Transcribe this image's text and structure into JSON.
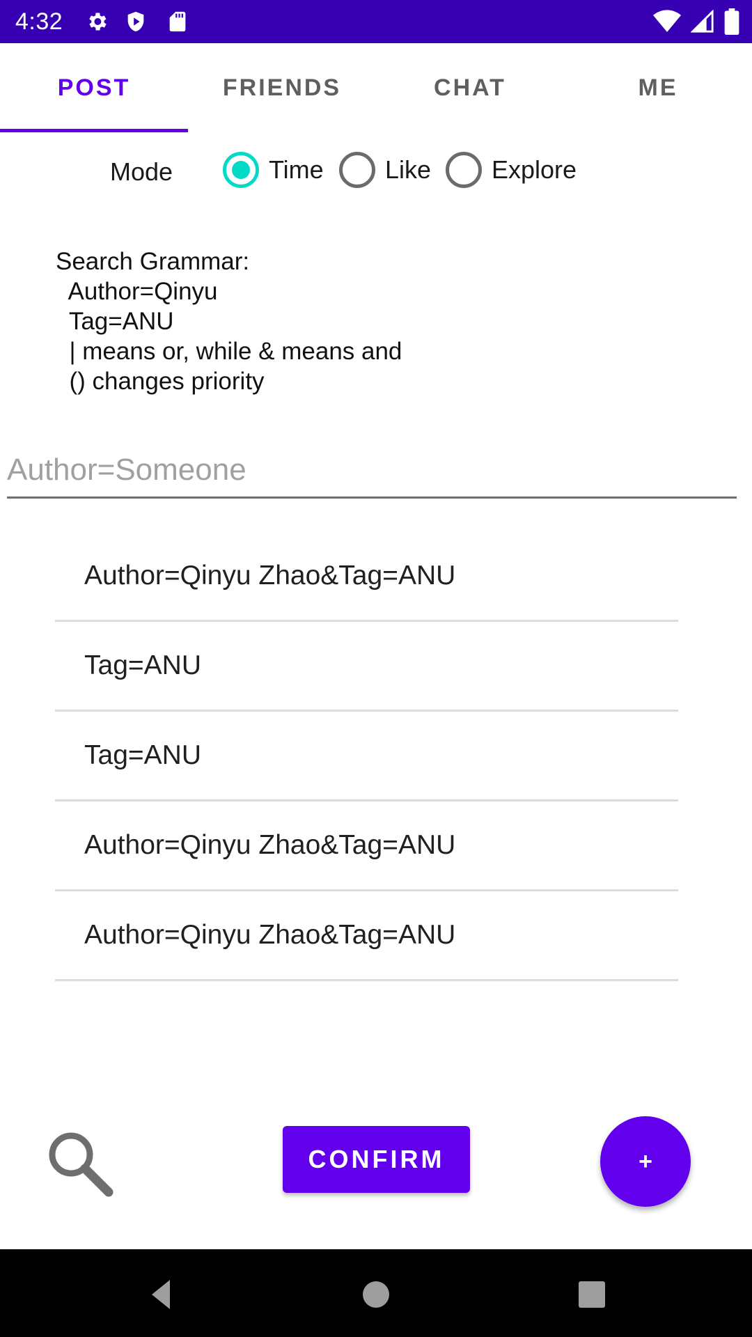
{
  "status_bar": {
    "time": "4:32",
    "icons_left": [
      "gear-icon",
      "play-protect-icon",
      "sd-card-icon"
    ],
    "icons_right": [
      "wifi-icon",
      "signal-icon",
      "battery-icon"
    ]
  },
  "tabs": [
    {
      "label": "POST",
      "active": true
    },
    {
      "label": "FRIENDS",
      "active": false
    },
    {
      "label": "CHAT",
      "active": false
    },
    {
      "label": "ME",
      "active": false
    }
  ],
  "mode": {
    "label": "Mode",
    "options": [
      {
        "label": "Time",
        "checked": true
      },
      {
        "label": "Like",
        "checked": false
      },
      {
        "label": "Explore",
        "checked": false
      }
    ]
  },
  "grammar": {
    "lines": [
      "Search Grammar:",
      "  Author=Qinyu",
      "  Tag=ANU",
      "  | means or, while & means and",
      "  () changes priority"
    ]
  },
  "search": {
    "value": "",
    "placeholder": "Author=Someone"
  },
  "history": [
    "Author=Qinyu Zhao&Tag=ANU",
    "Tag=ANU",
    "Tag=ANU",
    "Author=Qinyu Zhao&Tag=ANU",
    "Author=Qinyu Zhao&Tag=ANU"
  ],
  "actions": {
    "confirm_label": "CONFIRM",
    "fab_label": "+"
  },
  "colors": {
    "status_bar": "#3700b3",
    "primary": "#6200ee",
    "radio_accent": "#03dac5"
  },
  "nav_bar": [
    "back-icon",
    "home-icon",
    "recents-icon"
  ]
}
